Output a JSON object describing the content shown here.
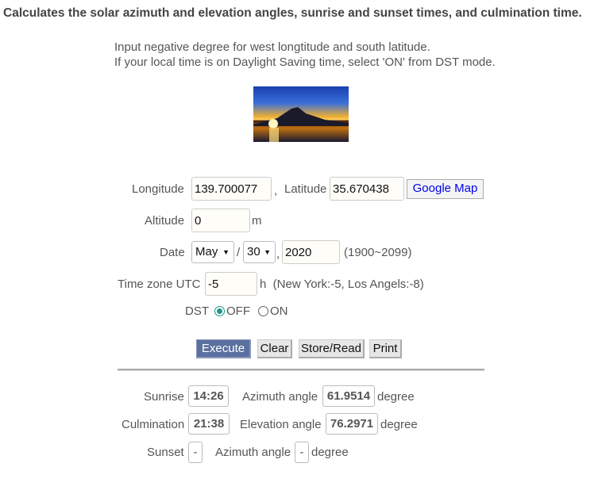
{
  "title": "Calculates the solar azimuth and elevation angles, sunrise and sunset times, and culmination time.",
  "notes": [
    "Input negative degree for west longtitude and south latitude.",
    "If your local time is on Daylight Saving time, select 'ON' from DST mode."
  ],
  "form": {
    "longitude_label": "Longitude",
    "longitude": "139.700077",
    "comma": ",",
    "latitude_label": "Latitude",
    "latitude": "35.670438",
    "google_map": "Google Map",
    "altitude_label": "Altitude",
    "altitude": "0",
    "altitude_unit": "m",
    "date_label": "Date",
    "month": "May",
    "day": "30",
    "slash": "/",
    "year": "2020",
    "year_range": "(1900~2099)",
    "tz_label": "Time zone UTC",
    "tz": "-5",
    "tz_hint": "h  (New York:-5, Los Angels:-8)",
    "dst_label": "DST",
    "dst_off": "OFF",
    "dst_on": "ON",
    "dst_selected": "OFF"
  },
  "buttons": {
    "execute": "Execute",
    "clear": "Clear",
    "store": "Store/Read",
    "print": "Print"
  },
  "results": {
    "sunrise_label": "Sunrise",
    "sunrise": "14:26",
    "az1_label": "Azimuth angle",
    "az1": "61.9514",
    "culm_label": "Culmination",
    "culm": "21:38",
    "elev_label": "Elevation angle",
    "elev": "76.2971",
    "sunset_label": "Sunset",
    "sunset": "-",
    "az2_label": "Azimuth angle",
    "az2": "-",
    "unit": "degree"
  },
  "colors": {
    "execute_bg": "#5a70a0",
    "radio_accent": "#1a9a8a",
    "link": "#0000ee"
  }
}
